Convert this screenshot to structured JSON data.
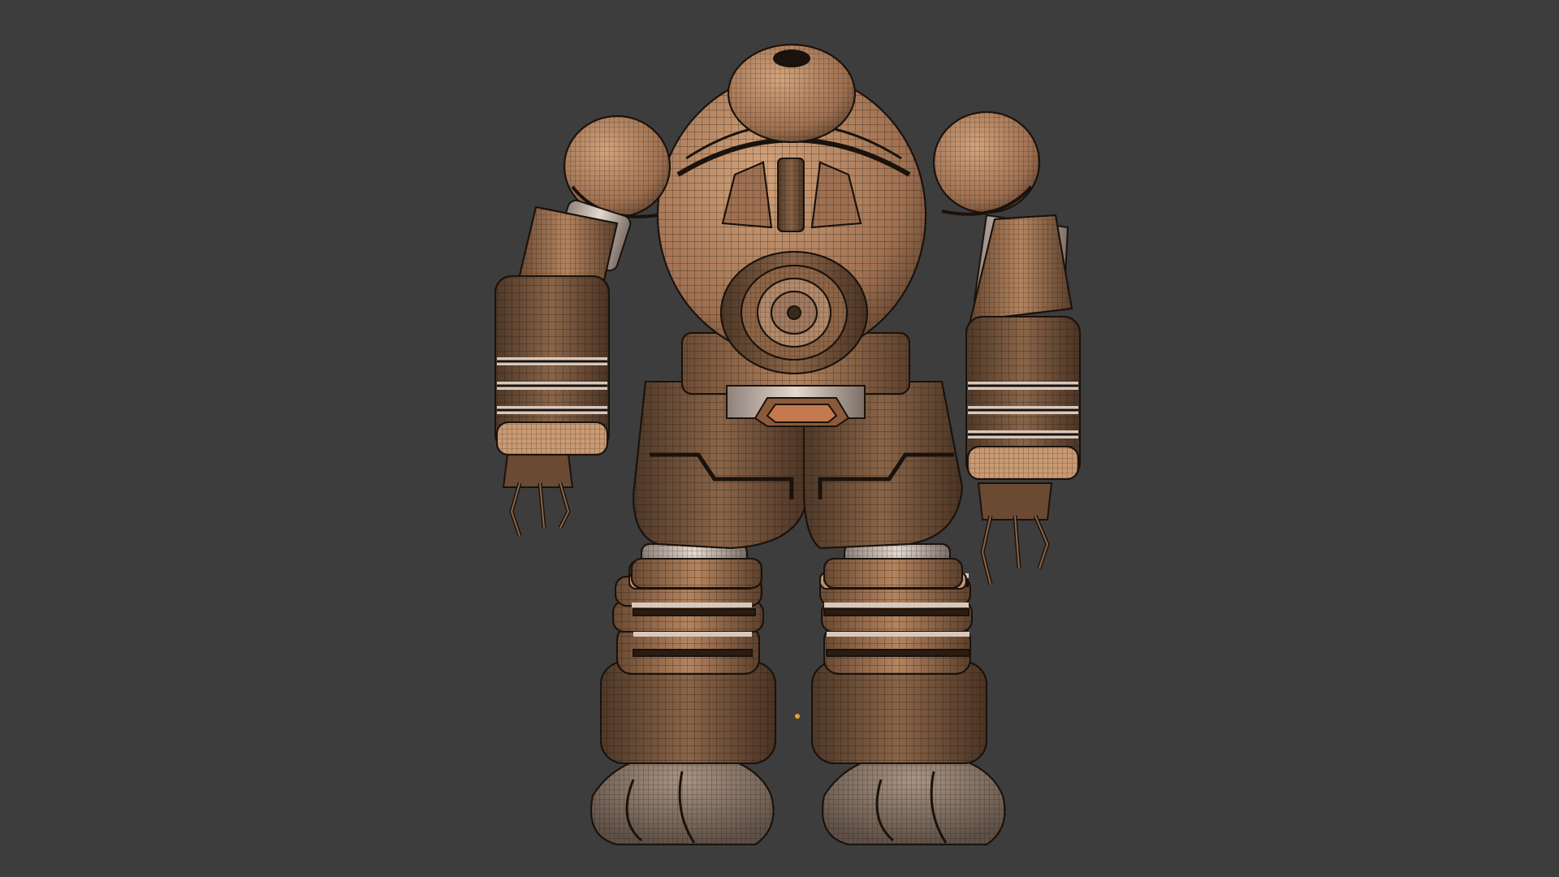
{
  "viewport": {
    "background": "#3d3d3d",
    "mode": "solid-shaded-wireframe-overlay"
  },
  "model": {
    "subject": "mech-robot",
    "colors": {
      "base": "#a97a58",
      "light": "#c99a73",
      "dark": "#6a4a33",
      "deep": "#4a3324",
      "pale": "#d8c8bc",
      "wire": "#1a120c",
      "foot": "#8a7868"
    }
  },
  "origin_marker": {
    "color": "#e8a02a"
  }
}
